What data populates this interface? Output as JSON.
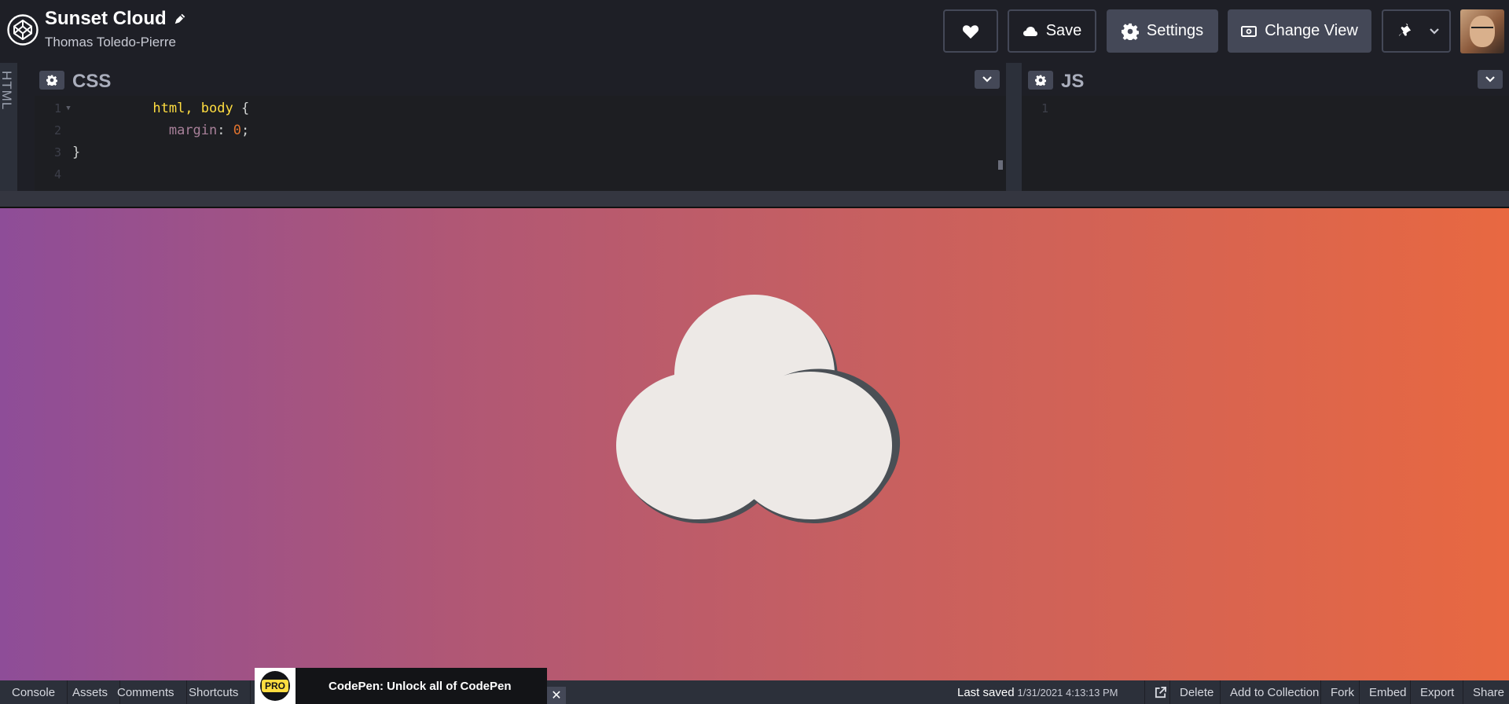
{
  "header": {
    "pen_title": "Sunset Cloud",
    "author": "Thomas Toledo-Pierre",
    "save_label": "Save",
    "settings_label": "Settings",
    "change_view_label": "Change View"
  },
  "editors": {
    "html_label": "HTML",
    "css": {
      "title": "CSS",
      "lines": [
        {
          "num": "1",
          "selector": "html, body",
          "open": " {"
        },
        {
          "num": "2",
          "prop": "  margin",
          "colon": ": ",
          "value": "0",
          "end": ";"
        },
        {
          "num": "3",
          "close": "}"
        },
        {
          "num": "4"
        }
      ]
    },
    "js": {
      "title": "JS",
      "line1": "1"
    }
  },
  "bottom_bar": {
    "console": "Console",
    "assets": "Assets",
    "comments": "Comments",
    "shortcuts": "Shortcuts",
    "last_saved_label": "Last saved",
    "last_saved_time": "1/31/2021 4:13:13 PM",
    "delete": "Delete",
    "add_to_collection": "Add to Collection",
    "fork": "Fork",
    "embed": "Embed",
    "export": "Export",
    "share": "Share"
  },
  "promo": {
    "badge": "PRO",
    "text": "CodePen: Unlock all of CodePen",
    "close": "✕"
  },
  "colors": {
    "gradient_start": "#8e4d98",
    "gradient_end": "#e86841",
    "cloud": "#ede9e6",
    "cloud_shadow": "#4a4f55"
  }
}
